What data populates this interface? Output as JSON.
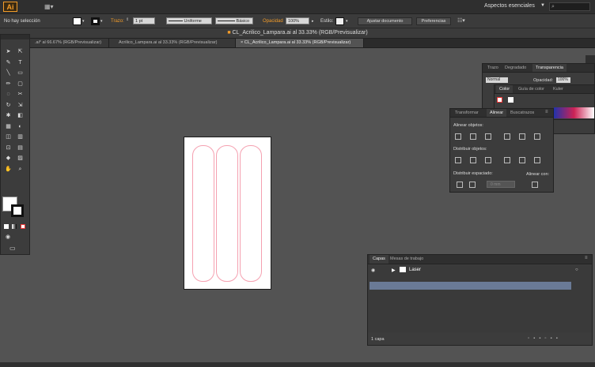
{
  "app": {
    "logo": "Ai",
    "arrange_icon": "arrange-documents-icon",
    "workspace": "Aspectos esenciales",
    "search_icon": "search-icon"
  },
  "control": {
    "selection": "No hay selección",
    "stroke_label": "Trazo:",
    "stroke_weight": "1 pt",
    "profile": "Uniforme",
    "brush": "Básico",
    "opacity_label": "Opacidad",
    "opacity_value": "100%",
    "style_label": "Estilo:",
    "adjust_button": "Ajustar documento",
    "prefs_button": "Preferencias",
    "colors": {
      "accent": "#f39c29",
      "canvas": "#535353",
      "panel": "#3c3c3c"
    }
  },
  "document": {
    "title": "CL_Acrilico_Lampara.ai al 33.33% (RGB/Previsualizar)",
    "tabs": [
      {
        "label": ".ai* al 66.67% (RGB/Previsualizar)"
      },
      {
        "label": "Acrilico_Lampara.ai al 33.33% (RGB/Previsualizar)"
      },
      {
        "label": "CL_Acrilico_Lampara.ai al 33.33% (RGB/Previsualizar)"
      }
    ]
  },
  "panels": {
    "top": {
      "tabs": [
        "Trazo",
        "Degradado",
        "Transparencia"
      ],
      "blend": "Normal",
      "opacity_label": "Opacidad:",
      "opacity_value": "100%"
    },
    "color": {
      "tabs": [
        "Color",
        "Guía de color",
        "Kuler"
      ]
    },
    "align": {
      "tabs": [
        "Transformar",
        "Alinear",
        "Buscatrazos"
      ],
      "align_objects": "Alinear objetos:",
      "distribute_objects": "Distribuir objetos:",
      "distribute_spacing": "Distribuir espaciado:",
      "align_to": "Alinear con:",
      "spacing_value": "0 mm"
    },
    "layers": {
      "tabs": [
        "Capas",
        "Mesas de trabajo"
      ],
      "layer_name": "Laser",
      "count": "1 capa"
    }
  }
}
